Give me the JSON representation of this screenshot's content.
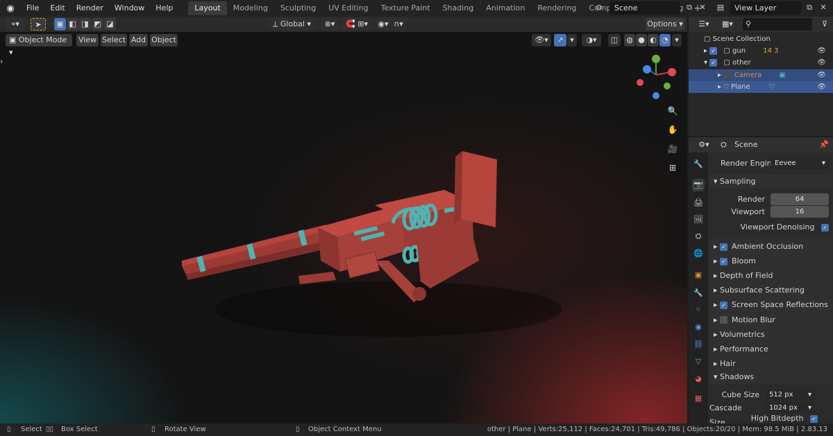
{
  "app": {
    "menu": [
      "File",
      "Edit",
      "Render",
      "Window",
      "Help"
    ],
    "workspaces": [
      "Layout",
      "Modeling",
      "Sculpting",
      "UV Editing",
      "Texture Paint",
      "Shading",
      "Animation",
      "Rendering",
      "Compositing",
      "Scripting"
    ],
    "active_workspace": "Layout",
    "scene_name": "Scene",
    "view_layer": "View Layer"
  },
  "viewport_header": {
    "transform_orientation": "Global",
    "options_label": "Options",
    "mode": "Object Mode",
    "menus": [
      "View",
      "Select",
      "Add",
      "Object"
    ]
  },
  "outliner": {
    "root": "Scene Collection",
    "rows": [
      {
        "name": "gun",
        "badges": "14  3"
      },
      {
        "name": "other"
      },
      {
        "name": "Camera"
      },
      {
        "name": "Plane"
      }
    ]
  },
  "properties": {
    "context": "Scene",
    "render_engine_label": "Render Engine",
    "render_engine": "Eevee",
    "sampling": {
      "title": "Sampling",
      "render_label": "Render",
      "render_value": "64",
      "viewport_label": "Viewport",
      "viewport_value": "16",
      "denoise_label": "Viewport Denoising"
    },
    "panels": [
      {
        "label": "Ambient Occlusion",
        "checkbox": true
      },
      {
        "label": "Bloom",
        "checkbox": true
      },
      {
        "label": "Depth of Field",
        "checkbox": null
      },
      {
        "label": "Subsurface Scattering",
        "checkbox": null
      },
      {
        "label": "Screen Space Reflections",
        "checkbox": true
      },
      {
        "label": "Motion Blur",
        "checkbox": false
      },
      {
        "label": "Volumetrics",
        "checkbox": null
      },
      {
        "label": "Performance",
        "checkbox": null
      },
      {
        "label": "Hair",
        "checkbox": null
      }
    ],
    "shadows": {
      "title": "Shadows",
      "cube_label": "Cube Size",
      "cube_value": "512 px",
      "cascade_label": "Cascade Size",
      "cascade_value": "1024 px",
      "bitdepth_label": "High Bitdepth"
    }
  },
  "statusbar": {
    "select": "Select",
    "box_select": "Box Select",
    "rotate_view": "Rotate View",
    "context_menu": "Object Context Menu",
    "stats": "other | Plane | Verts:25,112 | Faces:24,701 | Tris:49,786 | Objects:20/20 | Mem: 98.5 MiB | 2.83.13"
  },
  "colors": {
    "accent": "#4772b3",
    "selected_row": "#334d80",
    "gun_red": "#b5453d",
    "gun_cyan": "#4fb3b0",
    "camera_orange": "#e08a3a"
  }
}
